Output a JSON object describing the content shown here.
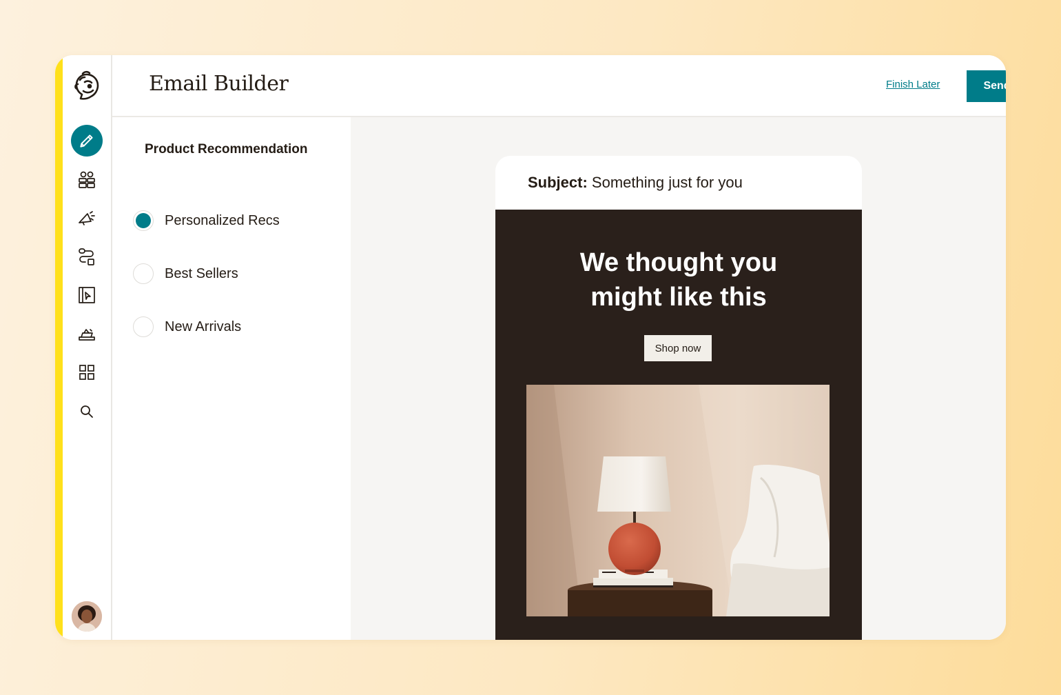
{
  "app": {
    "title": "Email Builder"
  },
  "header": {
    "finish_later": "Finish Later",
    "send": "Send"
  },
  "sidebar": {
    "items": [
      {
        "icon": "pencil-icon",
        "active": true
      },
      {
        "icon": "audience-icon",
        "active": false
      },
      {
        "icon": "campaigns-icon",
        "active": false
      },
      {
        "icon": "automations-icon",
        "active": false
      },
      {
        "icon": "website-icon",
        "active": false
      },
      {
        "icon": "content-icon",
        "active": false
      },
      {
        "icon": "integrations-icon",
        "active": false
      },
      {
        "icon": "search-icon",
        "active": false
      }
    ]
  },
  "panel": {
    "title": "Product Recommendation",
    "options": [
      {
        "label": "Personalized Recs",
        "selected": true
      },
      {
        "label": "Best Sellers",
        "selected": false
      },
      {
        "label": "New Arrivals",
        "selected": false
      }
    ]
  },
  "email": {
    "subject_label": "Subject:",
    "subject_value": "Something just for you",
    "headline_line1": "We thought you",
    "headline_line2": "might like this",
    "cta": "Shop now"
  },
  "colors": {
    "accent": "#007c89",
    "sidebar_stripe": "#ffe01b",
    "email_bg": "#2a201b"
  }
}
